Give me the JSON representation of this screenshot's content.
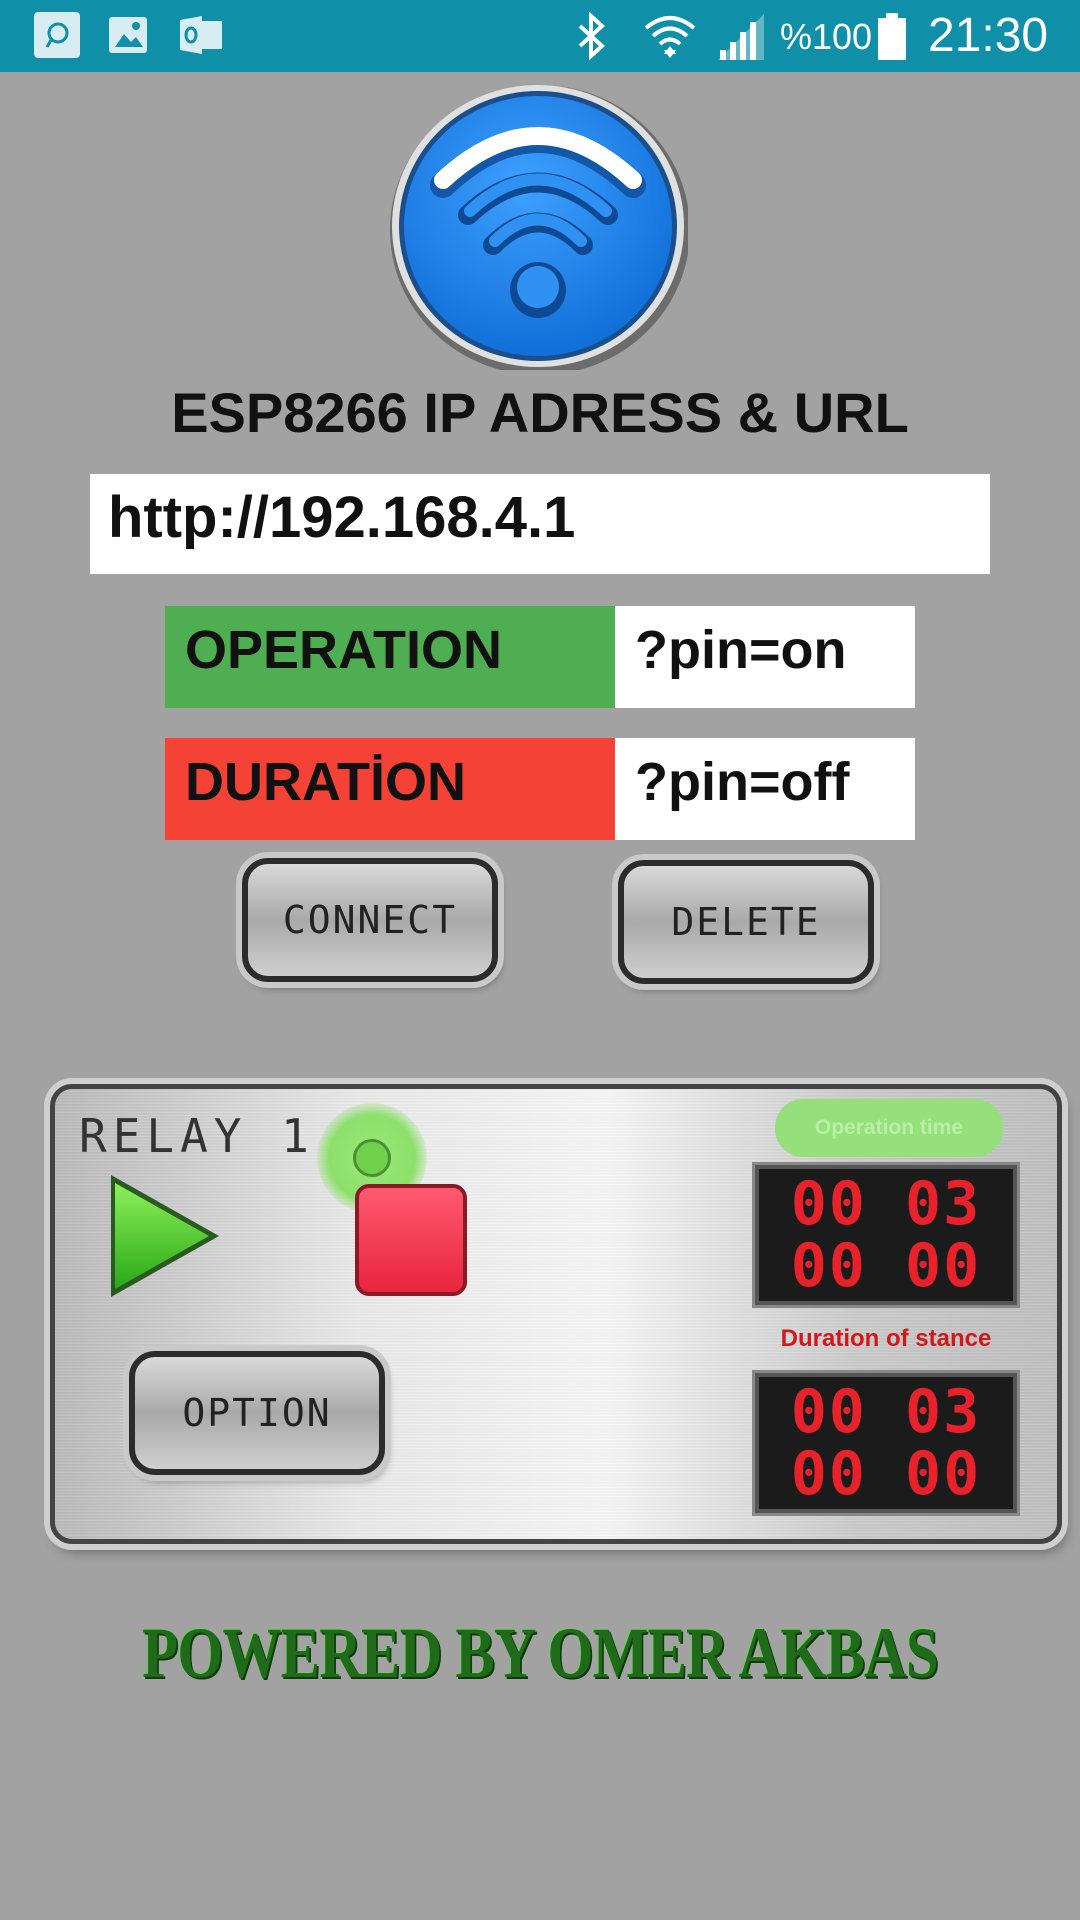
{
  "status_bar": {
    "battery_text": "%100",
    "time": "21:30",
    "icons": [
      "notification-app-icon",
      "gallery-icon",
      "outlook-icon",
      "bluetooth-icon",
      "wifi-icon",
      "signal-icon",
      "battery-icon"
    ]
  },
  "title": "ESP8266 IP ADRESS & URL",
  "url_value": "http://192.168.4.1",
  "operation": {
    "label": "OPERATION",
    "value": "?pin=on",
    "color": "#4fae51"
  },
  "duration": {
    "label": "DURATİON",
    "value": "?pin=off",
    "color": "#f44336"
  },
  "buttons": {
    "connect": "CONNECT",
    "delete": "DELETE",
    "option": "OPTION"
  },
  "relay": {
    "label": "RELAY 1",
    "operation_time_label": "Operation time",
    "operation_display": {
      "line1": "00 03",
      "line2": "00 00"
    },
    "duration_label": "Duration of stance",
    "duration_display": {
      "line1": "00 03",
      "line2": "00 00"
    }
  },
  "footer": "POWERED BY OMER AKBAS",
  "colors": {
    "status_bar": "#0f8fa8",
    "background": "#a2a2a2",
    "logo_blue": "#1e88e5",
    "display_red": "#e8222b"
  }
}
